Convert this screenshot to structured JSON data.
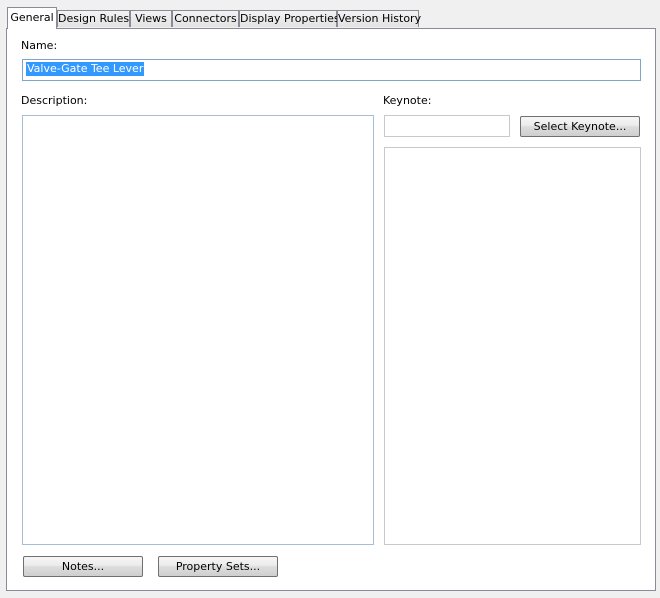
{
  "tabs": [
    {
      "label": "General",
      "active": true
    },
    {
      "label": "Design Rules",
      "active": false
    },
    {
      "label": "Views",
      "active": false
    },
    {
      "label": "Connectors",
      "active": false
    },
    {
      "label": "Display Properties",
      "active": false
    },
    {
      "label": "Version History",
      "active": false
    }
  ],
  "general": {
    "name_label": "Name:",
    "name_value": "Valve-Gate Tee Lever",
    "description_label": "Description:",
    "description_value": "",
    "keynote_label": "Keynote:",
    "keynote_value": "",
    "select_keynote_button": "Select Keynote...",
    "notes_button": "Notes...",
    "property_sets_button": "Property Sets..."
  },
  "colors": {
    "panel_background": "#ffffff",
    "window_background": "#f0f0f0",
    "selection_highlight": "#3399ff"
  }
}
